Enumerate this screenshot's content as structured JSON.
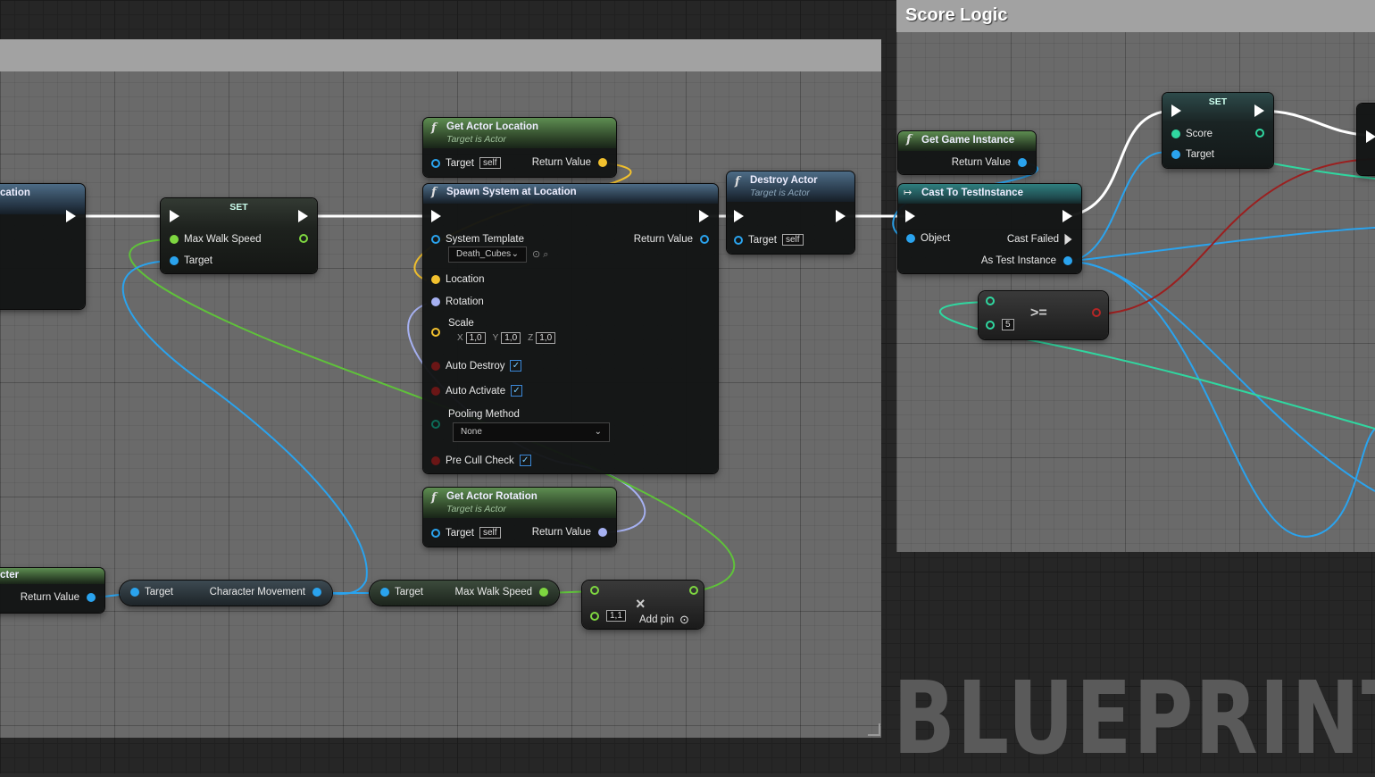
{
  "watermark": "BLUEPRINT",
  "comment_right": {
    "title": "Score Logic"
  },
  "nodes": {
    "left_location": {
      "title": "cation"
    },
    "set_walk": {
      "title": "SET",
      "pin_speed": "Max Walk Speed",
      "pin_target": "Target"
    },
    "get_actor_location": {
      "title": "Get Actor Location",
      "subtitle": "Target is Actor",
      "pin_target": "Target",
      "self": "self",
      "pin_return": "Return Value"
    },
    "spawn_system": {
      "title": "Spawn System at Location",
      "pin_template": "System Template",
      "template_value": "Death_Cubes",
      "pin_return": "Return Value",
      "pin_location": "Location",
      "pin_rotation": "Rotation",
      "pin_scale": "Scale",
      "scale": {
        "x_label": "X",
        "x": "1,0",
        "y_label": "Y",
        "y": "1,0",
        "z_label": "Z",
        "z": "1,0"
      },
      "pin_auto_destroy": "Auto Destroy",
      "pin_auto_activate": "Auto Activate",
      "pin_pooling": "Pooling Method",
      "pooling_value": "None",
      "pin_precull": "Pre Cull Check"
    },
    "destroy_actor": {
      "title": "Destroy Actor",
      "subtitle": "Target is Actor",
      "pin_target": "Target",
      "self": "self"
    },
    "get_actor_rotation": {
      "title": "Get Actor Rotation",
      "subtitle": "Target is Actor",
      "pin_target": "Target",
      "self": "self",
      "pin_return": "Return Value"
    },
    "left_character": {
      "title": "cter",
      "pin_return": "Return Value"
    },
    "char_movement": {
      "pin_target": "Target",
      "pin_out": "Character Movement"
    },
    "max_walk_speed_get": {
      "pin_target": "Target",
      "pin_out": "Max Walk Speed"
    },
    "multiply": {
      "value": "1,1",
      "symbol": "×",
      "add_pin": "Add pin"
    },
    "get_game_instance": {
      "title": "Get Game Instance",
      "pin_return": "Return Value"
    },
    "cast_to": {
      "title": "Cast To TestInstance",
      "pin_object": "Object",
      "pin_failed": "Cast Failed",
      "pin_as": "As Test Instance"
    },
    "compare": {
      "value": "5",
      "symbol": ">="
    },
    "set_score": {
      "title": "SET",
      "pin_score": "Score",
      "pin_target": "Target"
    }
  },
  "colors": {
    "exec": "#ffffff",
    "float": "#7ed640",
    "object": "#2aa3ee",
    "vector": "#f2c12e",
    "rotator": "#a6b1f2",
    "bool": "#8e1a1a",
    "int": "#30d7a0",
    "byte": "#0c6b57"
  }
}
